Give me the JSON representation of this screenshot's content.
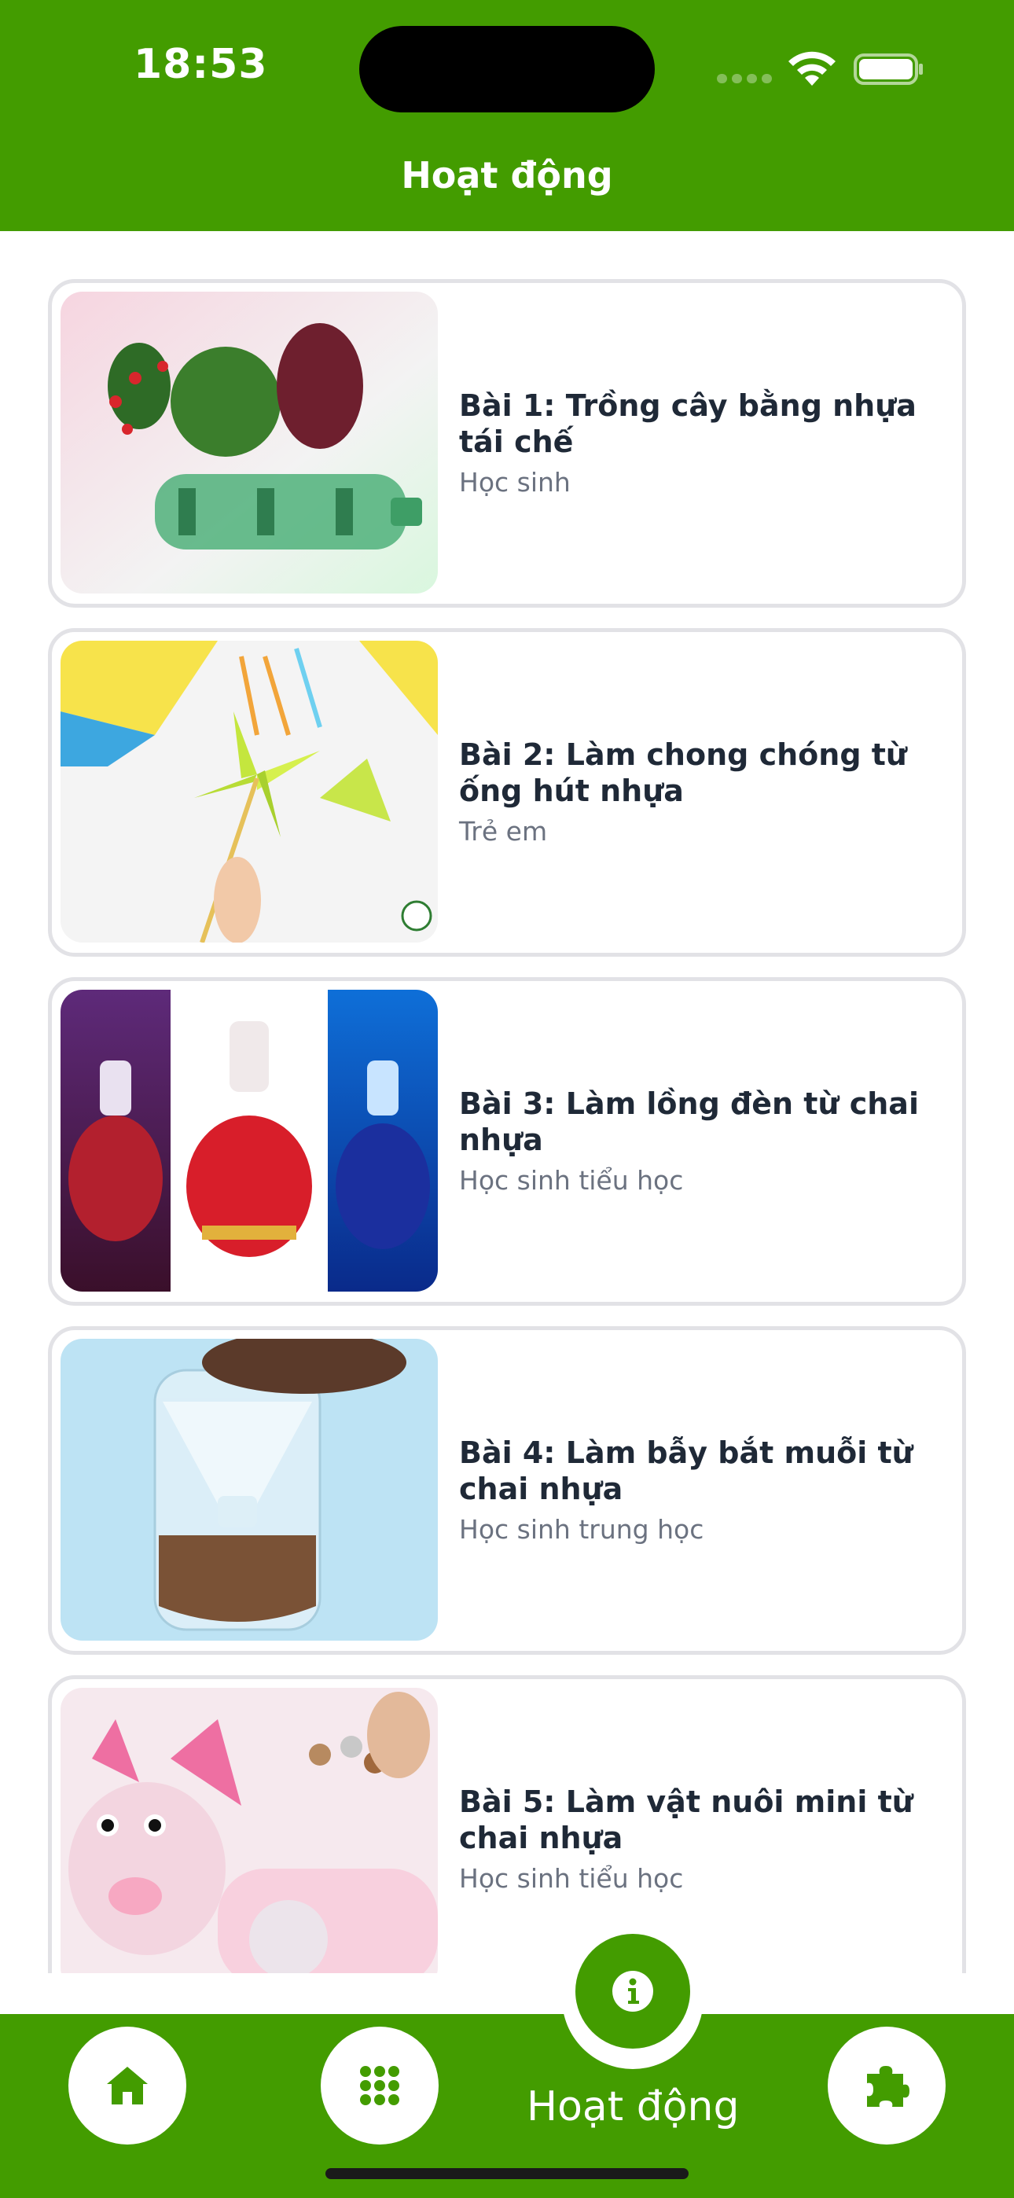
{
  "status_bar": {
    "time": "18:53"
  },
  "header": {
    "title": "Hoạt động"
  },
  "activities": [
    {
      "title": "Bài 1: Trồng cây bằng nhựa tái chế",
      "subtitle": "Học sinh"
    },
    {
      "title": "Bài 2: Làm chong chóng từ ống hút nhựa",
      "subtitle": "Trẻ em"
    },
    {
      "title": "Bài 3: Làm lồng đèn từ chai nhựa",
      "subtitle": "Học sinh tiểu học"
    },
    {
      "title": "Bài 4: Làm bẫy bắt muỗi từ chai nhựa",
      "subtitle": "Học sinh trung học"
    },
    {
      "title": "Bài 5: Làm vật nuôi mini từ chai nhựa",
      "subtitle": "Học sinh tiểu học"
    }
  ],
  "bottom_nav": {
    "active_label": "Hoạt động",
    "items": [
      {
        "icon": "home-icon"
      },
      {
        "icon": "grid-icon"
      },
      {
        "icon": "info-icon"
      },
      {
        "icon": "puzzle-icon"
      }
    ]
  },
  "colors": {
    "brand": "#439C00",
    "card_border": "#E2E2E6",
    "title": "#1F2937",
    "subtitle": "#6B7280"
  }
}
